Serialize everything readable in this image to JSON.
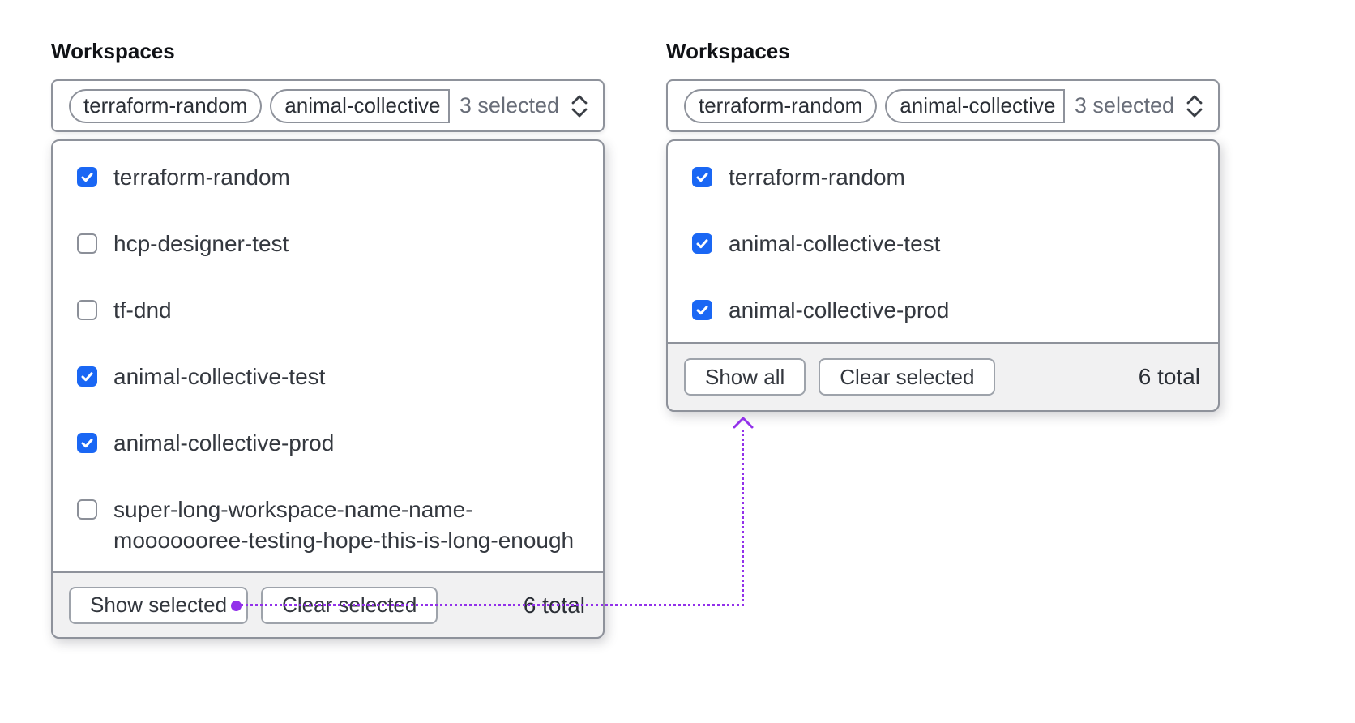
{
  "colors": {
    "checkbox_blue": "#1a67f4",
    "annotation_purple": "#9231ea"
  },
  "left": {
    "label": "Workspaces",
    "trigger": {
      "tags": [
        "terraform-random",
        "animal-collective"
      ],
      "count": "3 selected"
    },
    "items": [
      {
        "label": "terraform-random",
        "checked": true
      },
      {
        "label": "hcp-designer-test",
        "checked": false
      },
      {
        "label": "tf-dnd",
        "checked": false
      },
      {
        "label": "animal-collective-test",
        "checked": true
      },
      {
        "label": "animal-collective-prod",
        "checked": true
      },
      {
        "label": "super-long-workspace-name-name-mooooooree-testing-hope-this-is-long-enough",
        "checked": false
      }
    ],
    "footer": {
      "show_button": "Show selected",
      "clear_button": "Clear selected",
      "total": "6 total"
    }
  },
  "right": {
    "label": "Workspaces",
    "trigger": {
      "tags": [
        "terraform-random",
        "animal-collective"
      ],
      "count": "3 selected"
    },
    "items": [
      {
        "label": "terraform-random",
        "checked": true
      },
      {
        "label": "animal-collective-test",
        "checked": true
      },
      {
        "label": "animal-collective-prod",
        "checked": true
      }
    ],
    "footer": {
      "show_button": "Show all",
      "clear_button": "Clear selected",
      "total": "6 total"
    }
  }
}
